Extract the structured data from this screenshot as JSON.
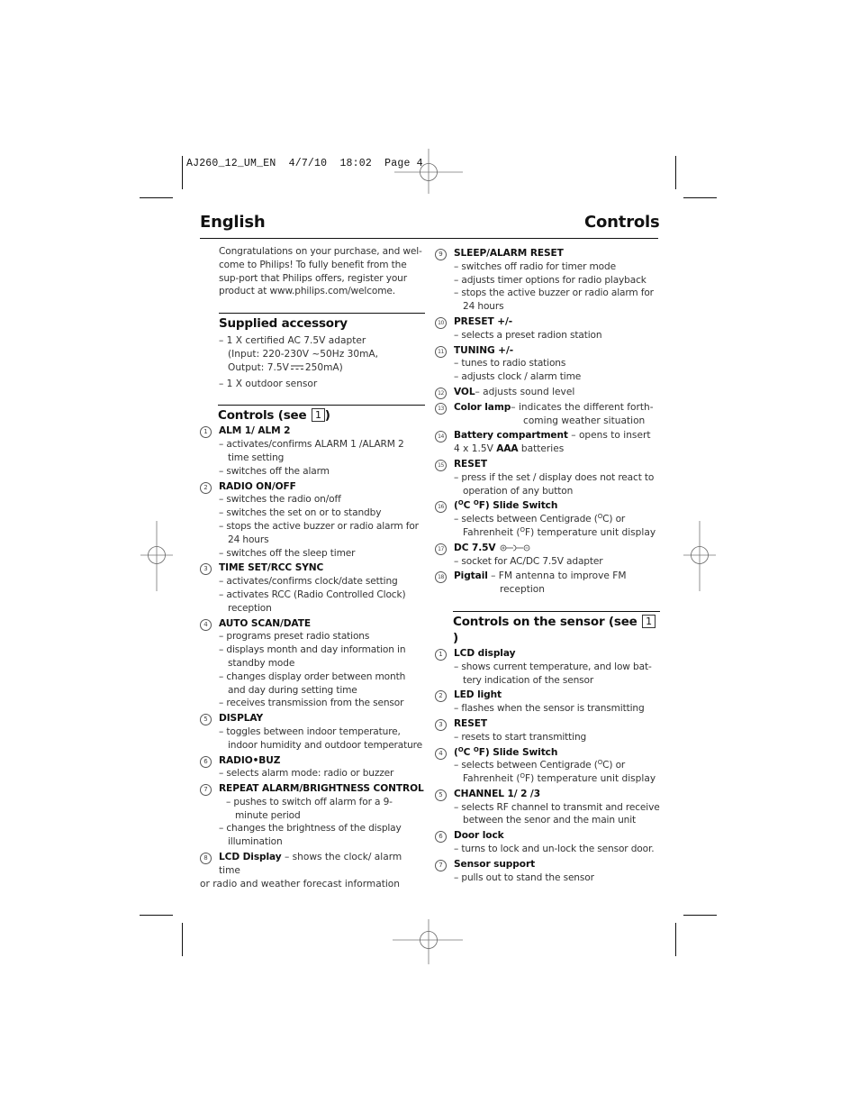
{
  "slug": {
    "file": "AJ260_12_UM_EN",
    "date": "4/7/10",
    "time": "18:02",
    "page_label": "Page 4"
  },
  "header": {
    "language": "English",
    "section": "Controls"
  },
  "intro": "Congratulations on your purchase, and wel-come to Philips! To fully benefit from the sup-port that Philips offers, register your product at www.philips.com/welcome.",
  "supplied": {
    "title": "Supplied accessory",
    "items": [
      "– 1 X certified AC 7.5V adapter",
      "(Input: 220-230V ~50Hz 30mA,",
      "Output: 7.5V",
      "250mA)",
      "– 1 X outdoor sensor"
    ]
  },
  "controls": {
    "title": "Controls (see ",
    "ref": "1",
    "close": ")",
    "items": [
      {
        "n": "1",
        "title": "ALM 1/ ALM 2",
        "bullets": [
          "– activates/confirms ALARM 1 /ALARM 2 time setting",
          "– switches off the alarm"
        ]
      },
      {
        "n": "2",
        "title": "RADIO ON/OFF",
        "bullets": [
          "– switches the radio on/off",
          "– switches the set on or to standby",
          "– stops the active buzzer or radio alarm for 24 hours",
          "– switches off the sleep timer"
        ]
      },
      {
        "n": "3",
        "title": "TIME SET/RCC SYNC",
        "bullets": [
          "– activates/confirms clock/date setting",
          "– activates RCC (Radio Controlled Clock) reception"
        ]
      },
      {
        "n": "4",
        "title": "AUTO SCAN/DATE",
        "bullets": [
          "– programs preset radio stations",
          "– displays month and day information in standby mode",
          "– changes display order between month and day during setting time",
          "– receives transmission from the sensor"
        ]
      },
      {
        "n": "5",
        "title": "DISPLAY",
        "bullets": [
          "– toggles between indoor temperature, indoor humidity and outdoor temperature"
        ]
      },
      {
        "n": "6",
        "title": "RADIO•BUZ",
        "bullets": [
          "– selects alarm mode: radio or buzzer"
        ]
      },
      {
        "n": "7",
        "title": "REPEAT ALARM/BRIGHTNESS CONTROL",
        "bullets": [
          "– pushes to switch off alarm for a 9-minute period",
          "– changes the brightness of the display illumination"
        ]
      },
      {
        "n": "8",
        "title": "LCD Display",
        "desc": " – shows the clock/ alarm time or radio and weather forecast information"
      },
      {
        "n": "9",
        "title": "SLEEP/ALARM RESET",
        "bullets": [
          "– switches off radio for timer mode",
          "– adjusts timer options for radio playback",
          "– stops the active buzzer or radio alarm for 24 hours"
        ]
      },
      {
        "n": "10",
        "title": "PRESET +/-",
        "bullets": [
          "– selects a preset radion station"
        ]
      },
      {
        "n": "11",
        "title": "TUNING +/-",
        "bullets": [
          "– tunes to radio stations",
          "– adjusts clock / alarm time"
        ]
      },
      {
        "n": "12",
        "title": "VOL",
        "desc": "– adjusts sound level"
      },
      {
        "n": "13",
        "title": "Color lamp",
        "desc": "– indicates the different forth-",
        "desc2": "coming weather situation"
      },
      {
        "n": "14",
        "title": "Battery compartment",
        "desc": " – opens to insert",
        "desc_line2_a": "4 x 1.5V ",
        "desc_line2_b": "AAA",
        "desc_line2_c": " batteries"
      },
      {
        "n": "15",
        "title": "RESET",
        "bullets": [
          "– press if the set / display does not react to operation of any button"
        ]
      },
      {
        "n": "16",
        "title_a": "(",
        "title_sup1": "O",
        "title_b": "C ",
        "title_sup2": "O",
        "title_c": "F) Slide Switch",
        "b1_a": "– selects between Centigrade (",
        "b1_sup": "O",
        "b1_b": "C) or",
        "b2_a": "Fahrenheit (",
        "b2_sup": "O",
        "b2_b": "F) temperature unit display"
      },
      {
        "n": "17",
        "title": "DC 7.5V",
        "icon": "dc-polarity-icon",
        "bullets": [
          "– socket for AC/DC 7.5V adapter"
        ]
      },
      {
        "n": "18",
        "title": "Pigtail",
        "desc": " – FM antenna to improve FM",
        "desc2": "reception"
      }
    ]
  },
  "sensor": {
    "title": "Controls on the sensor (see ",
    "ref": "1",
    "close": ")",
    "items": [
      {
        "n": "1",
        "title": "LCD display",
        "bullets": [
          "– shows  current temperature, and low bat-tery indication of the sensor"
        ]
      },
      {
        "n": "2",
        "title": "LED light",
        "bullets": [
          "– flashes when the sensor is transmitting"
        ]
      },
      {
        "n": "3",
        "title": "RESET",
        "bullets": [
          "– resets to start transmitting"
        ]
      },
      {
        "n": "4",
        "title_a": "(",
        "title_sup1": "O",
        "title_b": "C ",
        "title_sup2": "O",
        "title_c": "F) Slide Switch",
        "b1_a": "– selects between Centigrade (",
        "b1_sup": "O",
        "b1_b": "C) or",
        "b2_a": "Fahrenheit (",
        "b2_sup": "O",
        "b2_b": "F) temperature unit display"
      },
      {
        "n": "5",
        "title": "CHANNEL 1/ 2 /3",
        "bullets": [
          "– selects RF channel to transmit and receive between the senor and the main unit"
        ]
      },
      {
        "n": "6",
        "title": "Door lock",
        "bullets": [
          "– turns to lock and un-lock the sensor door."
        ]
      },
      {
        "n": "7",
        "title": "Sensor support",
        "bullets": [
          "– pulls out to stand the sensor"
        ]
      }
    ]
  }
}
